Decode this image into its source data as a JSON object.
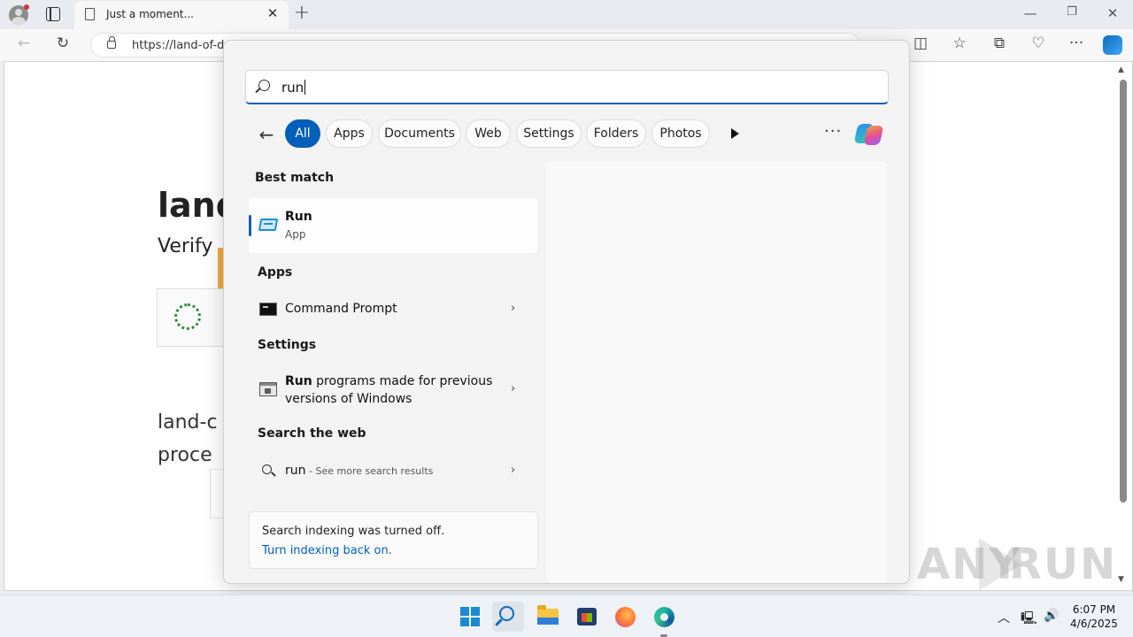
{
  "browser": {
    "tab_title": "Just a moment...",
    "url": "https://land-of-d",
    "window_controls": {
      "minimize": "—",
      "restore": "❐",
      "close": "✕"
    }
  },
  "page": {
    "heading": "land",
    "subheading": "Verify",
    "paragraph_line1": "land-c",
    "paragraph_line2": "proce"
  },
  "search": {
    "query": "run",
    "filters": [
      "All",
      "Apps",
      "Documents",
      "Web",
      "Settings",
      "Folders",
      "Photos"
    ],
    "active_filter": "All"
  },
  "results": {
    "best_match_heading": "Best match",
    "best_match": {
      "title": "Run",
      "type": "App"
    },
    "apps_heading": "Apps",
    "apps": [
      {
        "label": "Command Prompt"
      }
    ],
    "settings_heading": "Settings",
    "settings": [
      {
        "bold": "Run",
        "rest_line1": " programs made for previous",
        "line2": "versions of Windows"
      }
    ],
    "web_heading": "Search the web",
    "web": {
      "query": "run",
      "sub": " - See more search results"
    }
  },
  "indexing": {
    "message": "Search indexing was turned off.",
    "link": "Turn indexing back on."
  },
  "watermark": {
    "left": "ANY",
    "right": "RUN"
  },
  "taskbar": {
    "apps": [
      "start",
      "search",
      "file-explorer",
      "microsoft-store",
      "firefox",
      "edge"
    ],
    "time": "6:07 PM",
    "date": "4/6/2025"
  },
  "colors": {
    "accent": "#005fb8",
    "taskbar": "#eef1f5",
    "flyout": "#f3f3f3"
  }
}
